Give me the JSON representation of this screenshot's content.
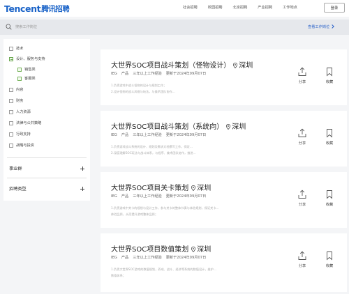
{
  "header": {
    "logo_en": "Tencent",
    "logo_cn": "腾讯招聘",
    "nav": [
      "社会招聘",
      "校园招聘",
      "北京招聘",
      "产业招聘",
      "工作地点"
    ],
    "login": "登录"
  },
  "search": {
    "placeholder": "搜索工作岗位",
    "view_jobs": "查看工作岗位"
  },
  "sidebar": {
    "categories": [
      {
        "label": "技术",
        "level": 0
      },
      {
        "label": "设计、服务与支持",
        "level": 0,
        "partial": true
      },
      {
        "label": "销售类",
        "level": 1
      },
      {
        "label": "客服类",
        "level": 1
      },
      {
        "label": "内容",
        "level": 0
      },
      {
        "label": "财务",
        "level": 0
      },
      {
        "label": "人力资源",
        "level": 0
      },
      {
        "label": "法律与公共策略",
        "level": 0
      },
      {
        "label": "行政支持",
        "level": 0
      },
      {
        "label": "战略与投资",
        "level": 0
      }
    ],
    "sections": [
      {
        "label": "事业群"
      },
      {
        "label": "招聘类型"
      }
    ]
  },
  "jobs": [
    {
      "title": "大世界SOC项目战斗策划（怪物设计）",
      "location": "深圳",
      "meta": [
        "IEG",
        "产品",
        "三年以上工作经验",
        "更新于2024年09月07日"
      ],
      "desc": [
        "1.负责游戏中战斗怪物的设计与规划工作；",
        "2.设计怪物的战斗风格与玩法，与美术团队协作…"
      ],
      "share": "分享",
      "collect": "收藏"
    },
    {
      "title": "大世界SOC项目战斗策划（系统向）",
      "location": "深圳",
      "meta": [
        "IEG",
        "产品",
        "三年以上工作经验",
        "更新于2024年09月07日"
      ],
      "desc": [
        "1.负责游戏战斗系统的设计、规划及需求文档撰写工作，保证…",
        "2.深度理解SOC玩法与战斗体系，与程序、美术团队协作，推进…"
      ],
      "share": "分享",
      "collect": "收藏"
    },
    {
      "title": "大世界SOC项目关卡策划",
      "location": "深圳",
      "meta": [
        "IEG",
        "产品",
        "三年以上工作经验",
        "更新于2024年09月07日"
      ],
      "desc": [
        "1.负责游戏中关卡的规划与设计工作，参与关卡的整体节奏与体验规划，保证关卡…",
        "体验品质，从而提升游戏整体品质；"
      ],
      "share": "分享",
      "collect": "收藏"
    },
    {
      "title": "大世界SOC项目数值策划",
      "location": "深圳",
      "meta": [
        "IEG",
        "产品",
        "三年以上工作经验",
        "更新于2024年09月07日"
      ],
      "desc": [
        "1.负责大世界SOC游戏的数值规划，养成、战斗、经济等系统的数值设计，维护…",
        "数值体系；"
      ],
      "share": "分享",
      "collect": "收藏"
    }
  ]
}
